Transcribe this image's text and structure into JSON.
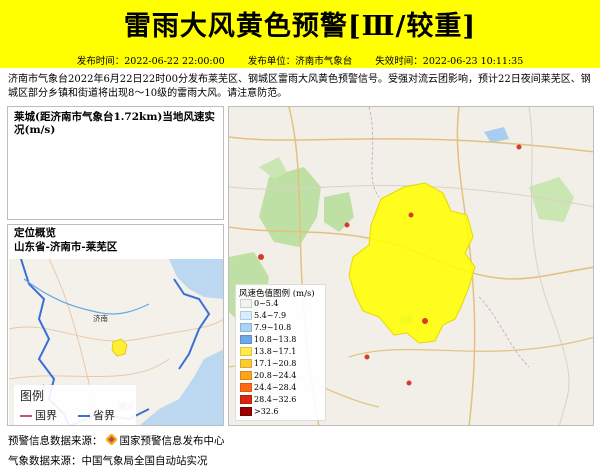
{
  "header": {
    "title": "雷雨大风黄色预警[Ⅲ/较重]",
    "publish_time": "发布时间：2022-06-22 22:00:00",
    "publisher": "发布单位：济南市气象台",
    "expire_time": "失效时间：2022-06-23 10:11:35",
    "bg_color": "#ffff00"
  },
  "description": "济南市气象台2022年6月22日22时00分发布莱芜区、钢城区雷雨大风黄色预警信号。受强对流云团影响，预计22日夜间莱芜区、钢城区部分乡镇和街道将出现8～10级的雷雨大风。请注意防范。",
  "wind_panel": {
    "title": "莱城(距济南市气象台1.72km)当地风速实况(m/s)"
  },
  "location_panel": {
    "title": "定位概览",
    "subtitle": "山东省-济南市-莱芜区",
    "legend_title": "图例",
    "legend_items": [
      {
        "label": "国界",
        "color": "#c0576e"
      },
      {
        "label": "省界",
        "color": "#3a6fd8"
      }
    ],
    "city_labels": [
      "济南",
      "济宁",
      "临沂"
    ],
    "highlight_color": "#ffee33"
  },
  "main_map": {
    "warning_area_color": "#ffff00",
    "legend_title": "风速色值图例 (m/s)",
    "legend_items": [
      {
        "label": "0~5.4",
        "color": "#f2f2f2"
      },
      {
        "label": "5.4~7.9",
        "color": "#d6ecff"
      },
      {
        "label": "7.9~10.8",
        "color": "#a9d4f5"
      },
      {
        "label": "10.8~13.8",
        "color": "#6fa8e8"
      },
      {
        "label": "13.8~17.1",
        "color": "#ffe94d"
      },
      {
        "label": "17.1~20.8",
        "color": "#ffc933"
      },
      {
        "label": "20.8~24.4",
        "color": "#ffa31a"
      },
      {
        "label": "24.4~28.4",
        "color": "#ff6a13"
      },
      {
        "label": "28.4~32.6",
        "color": "#d9260d"
      },
      {
        "label": ">32.6",
        "color": "#990000"
      }
    ]
  },
  "footer": {
    "warning_source_label": "预警信息数据来源：",
    "warning_source": "国家预警信息发布中心",
    "weather_source": "气象数据来源：中国气象局全国自动站实况"
  }
}
